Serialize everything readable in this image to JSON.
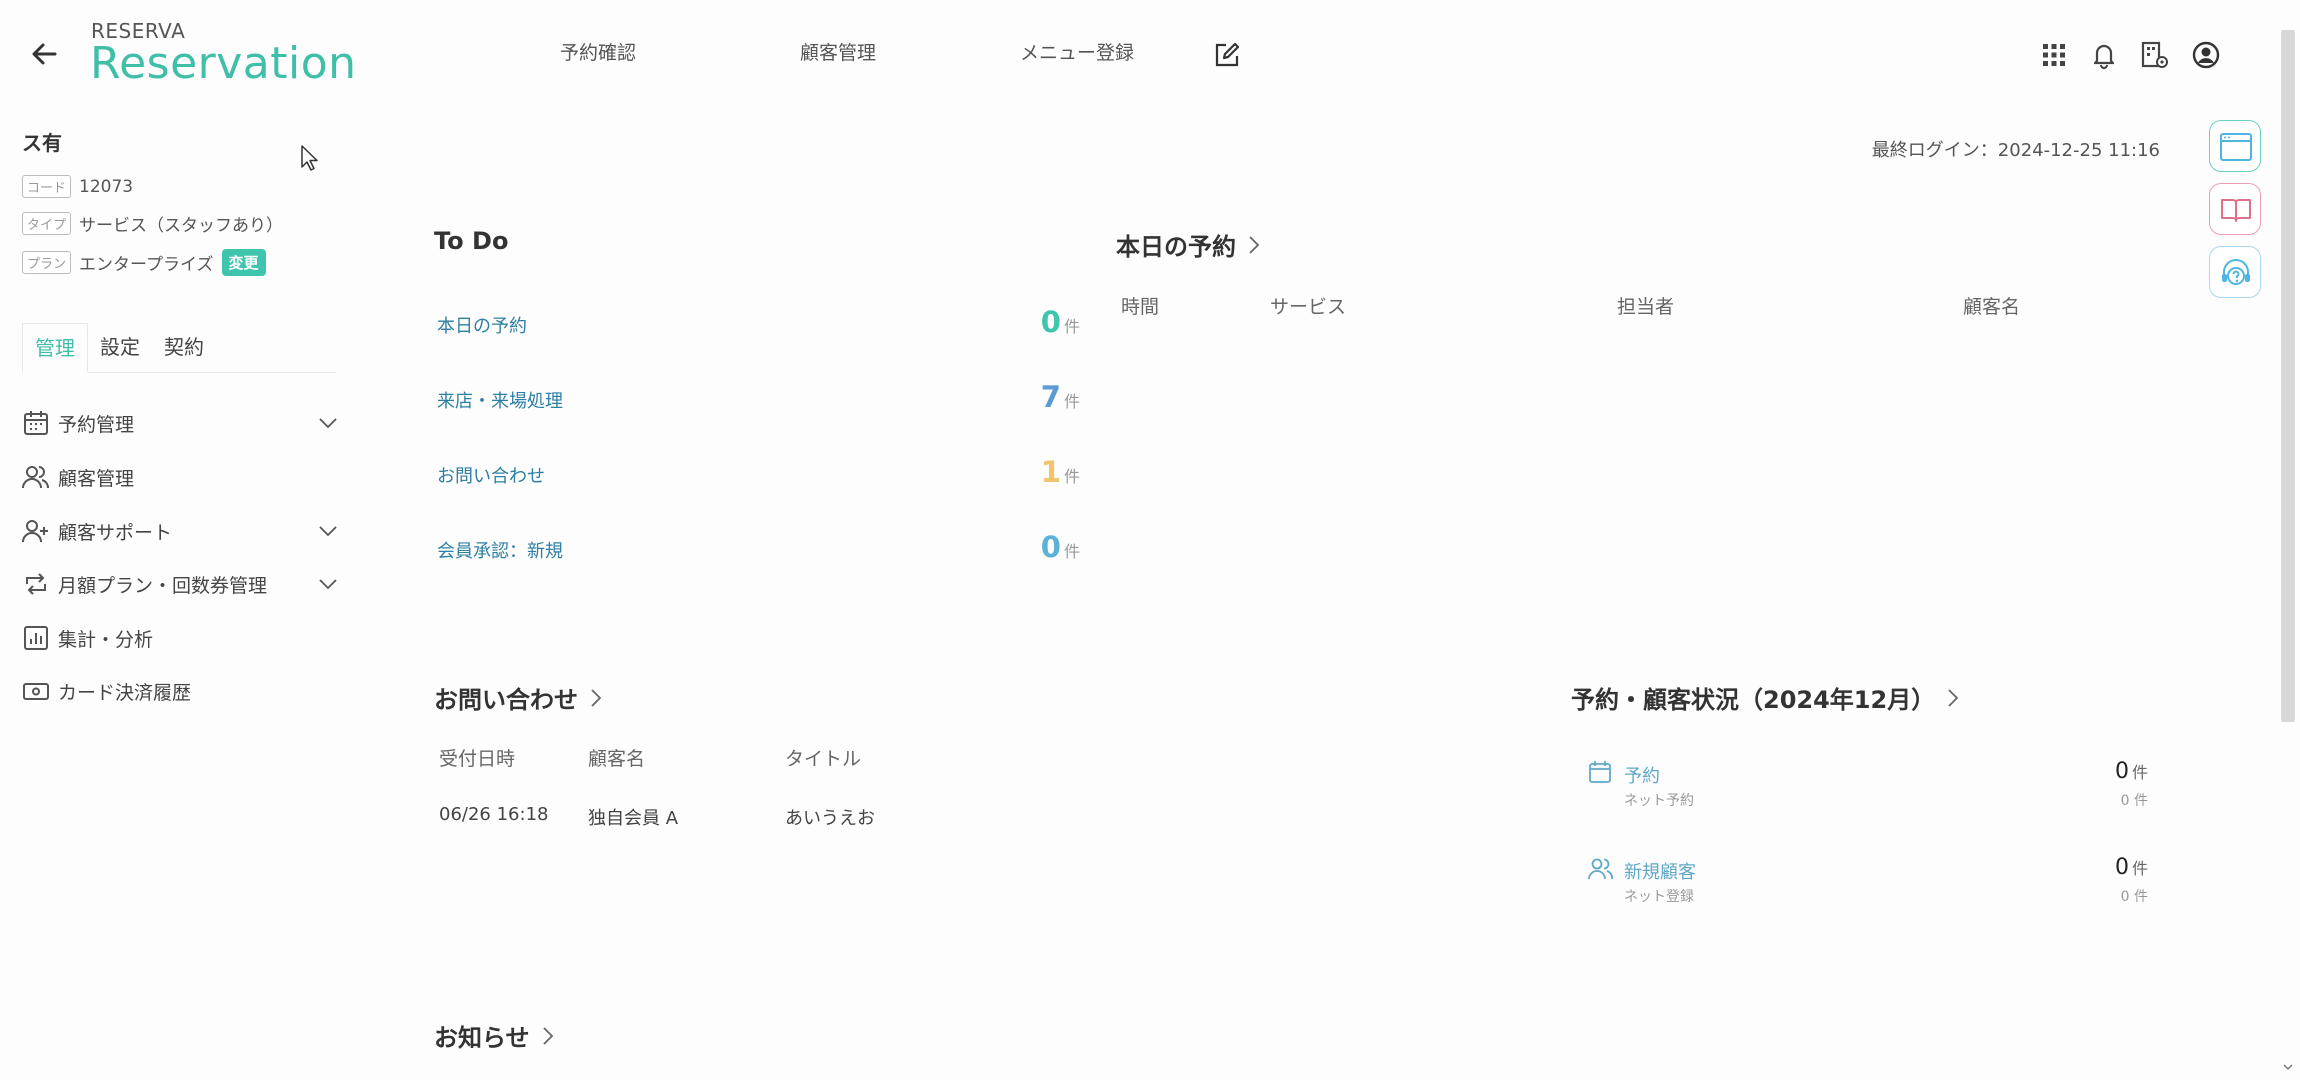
{
  "brand": {
    "small": "RESERVA",
    "big": "Reservation"
  },
  "topnav": {
    "reservation_check": "予約確認",
    "customer_mgmt": "顧客管理",
    "menu_register": "メニュー登録"
  },
  "store": {
    "name": "ス有",
    "code_tag": "コード",
    "code": "12073",
    "type_tag": "タイプ",
    "type": "サービス（スタッフあり）",
    "plan_tag": "プラン",
    "plan": "エンタープライズ",
    "change": "変更"
  },
  "side_tabs": [
    "管理",
    "設定",
    "契約"
  ],
  "side_menu": [
    {
      "label": "予約管理",
      "icon": "calendar-icon"
    },
    {
      "label": "顧客管理",
      "icon": "users-icon"
    },
    {
      "label": "顧客サポート",
      "icon": "user-plus-icon"
    },
    {
      "label": "月額プラン・回数券管理",
      "icon": "repeat-icon"
    },
    {
      "label": "集計・分析",
      "icon": "chart-icon"
    },
    {
      "label": "カード決済履歴",
      "icon": "card-icon"
    }
  ],
  "last_login": "最終ログイン：2024-12-25 11:16",
  "todo": {
    "title": "To Do",
    "unit": "件",
    "items": [
      {
        "label": "本日の予約",
        "count": "0",
        "color": "#3fc4ad"
      },
      {
        "label": "来店・来場処理",
        "count": "7",
        "color": "#5a9bd5"
      },
      {
        "label": "お問い合わせ",
        "count": "1",
        "color": "#f3c36b"
      },
      {
        "label": "会員承認：新規",
        "count": "0",
        "color": "#5ab3d6"
      }
    ]
  },
  "today": {
    "title": "本日の予約",
    "columns": [
      "時間",
      "サービス",
      "担当者",
      "顧客名"
    ]
  },
  "inquiry": {
    "title": "お問い合わせ",
    "columns": [
      "受付日時",
      "顧客名",
      "タイトル"
    ],
    "rows": [
      {
        "date": "06/26 16:18",
        "customer": "独自会員 A",
        "title": "あいうえお"
      }
    ]
  },
  "status": {
    "title": "予約・顧客状況（2024年12月）",
    "unit": "件",
    "items": [
      {
        "label": "予約",
        "sub": "ネット予約",
        "value": "0",
        "sub_value": "0 件",
        "icon": "calendar-icon"
      },
      {
        "label": "新規顧客",
        "sub": "ネット登録",
        "value": "0",
        "sub_value": "0 件",
        "icon": "users-icon"
      }
    ]
  },
  "news": {
    "title": "お知らせ"
  },
  "colors": {
    "accent": "#3fbfa8",
    "link": "#2d7fa3",
    "pink": "#e0708a",
    "sky": "#4fb5e0"
  }
}
